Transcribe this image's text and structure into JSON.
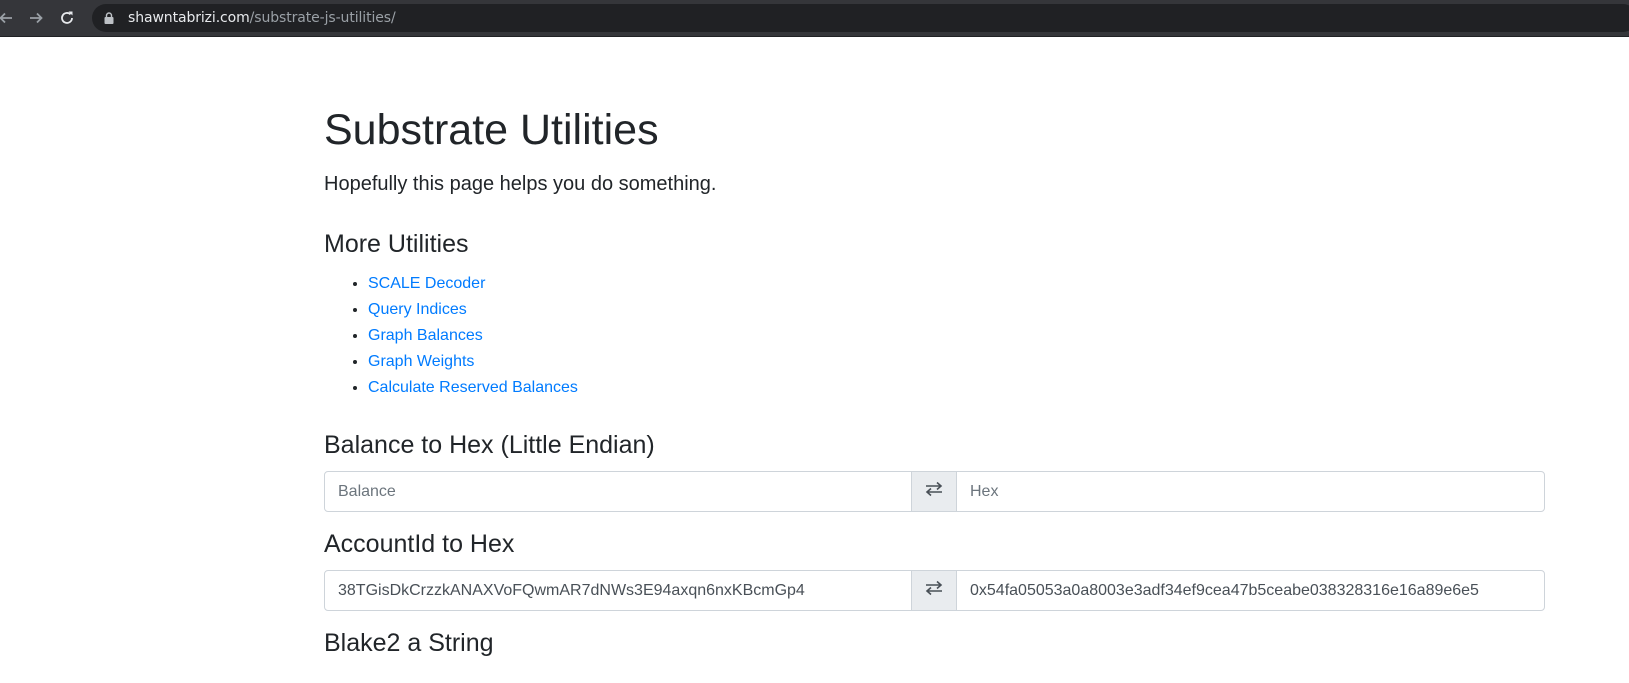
{
  "browser": {
    "url_host": "shawntabrizi.com",
    "url_path": "/substrate-js-utilities/",
    "icons": {
      "back": "arrow-left-icon",
      "forward": "arrow-right-icon",
      "reload": "reload-icon",
      "lock": "lock-icon"
    }
  },
  "page": {
    "title": "Substrate Utilities",
    "lead": "Hopefully this page helps you do something."
  },
  "more_utilities": {
    "heading": "More Utilities",
    "links": [
      {
        "label": "SCALE Decoder"
      },
      {
        "label": "Query Indices"
      },
      {
        "label": "Graph Balances"
      },
      {
        "label": "Graph Weights"
      },
      {
        "label": "Calculate Reserved Balances"
      }
    ]
  },
  "balance_to_hex": {
    "heading": "Balance to Hex (Little Endian)",
    "left_placeholder": "Balance",
    "left_value": "",
    "right_placeholder": "Hex",
    "right_value": "",
    "swap_icon": "swap-arrows-icon"
  },
  "accountid_to_hex": {
    "heading": "AccountId to Hex",
    "left_placeholder": "",
    "left_value": "38TGisDkCrzzkANAXVoFQwmAR7dNWs3E94axqn6nxKBcmGp4",
    "right_placeholder": "",
    "right_value": "0x54fa05053a0a8003e3adf34ef9cea47b5ceabe038328316e16a89e6e5",
    "swap_icon": "swap-arrows-icon"
  },
  "blake2_string": {
    "heading": "Blake2 a String"
  }
}
